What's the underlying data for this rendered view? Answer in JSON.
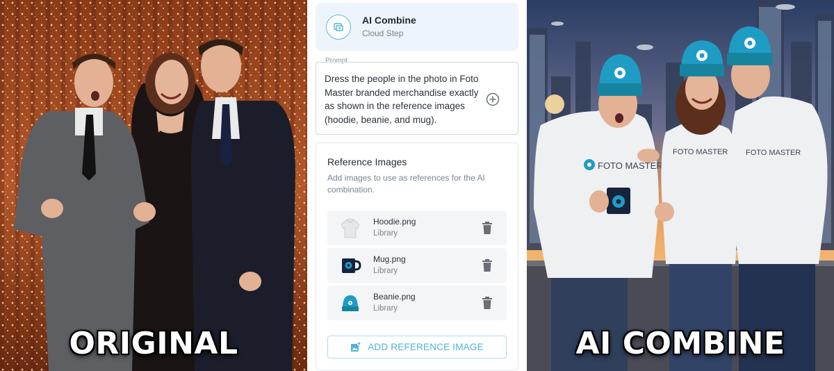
{
  "left_photo": {
    "caption": "ORIGINAL"
  },
  "right_photo": {
    "caption": "AI COMBINE",
    "shirt_text": "FOTO MASTER"
  },
  "step": {
    "title": "AI Combine",
    "subtitle": "Cloud Step",
    "icon": "ai-combine-icon"
  },
  "prompt": {
    "label": "Prompt",
    "value": "Dress the people in the photo in Foto Master branded merchandise exactly as shown in the reference images (hoodie, beanie, and mug).",
    "add_icon": "plus-circle-icon"
  },
  "references": {
    "title": "Reference Images",
    "description": "Add images to use as references for the AI combination.",
    "items": [
      {
        "name": "Hoodie.png",
        "source": "Library",
        "thumb": "hoodie"
      },
      {
        "name": "Mug.png",
        "source": "Library",
        "thumb": "mug"
      },
      {
        "name": "Beanie.png",
        "source": "Library",
        "thumb": "beanie"
      }
    ],
    "delete_icon": "trash-icon",
    "add_button": "ADD REFERENCE IMAGE"
  },
  "colors": {
    "accent": "#4fb3d6",
    "step_card_bg": "#eef4fb",
    "brand_teal": "#1e9cc4"
  }
}
